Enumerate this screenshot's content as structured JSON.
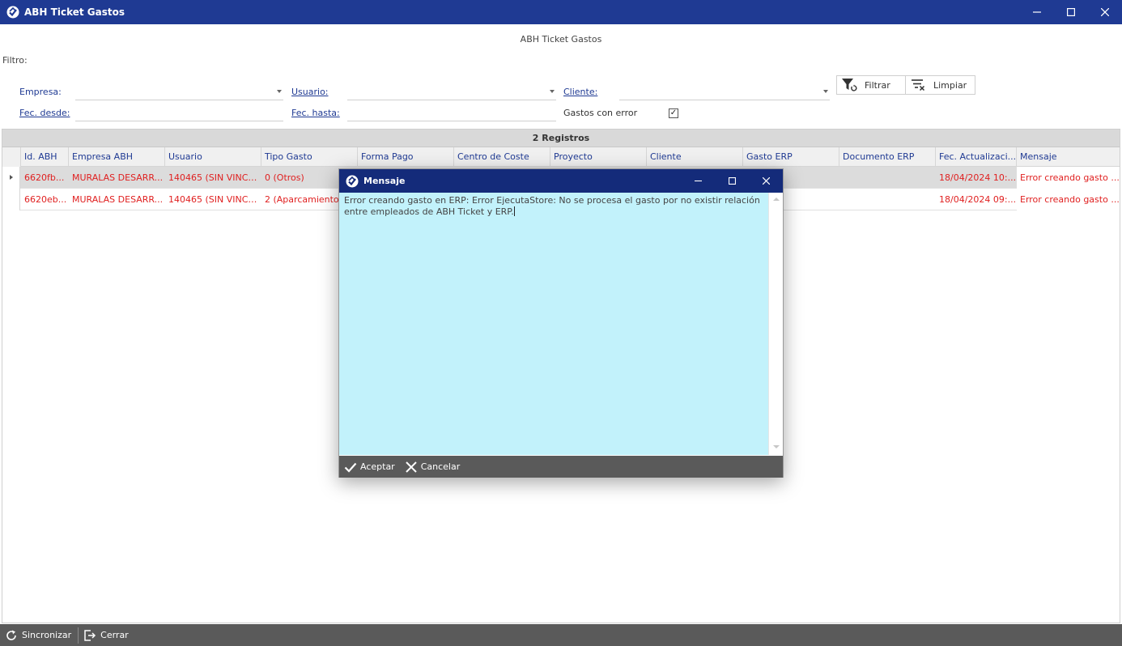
{
  "window": {
    "title": "ABH Ticket Gastos",
    "min": "–",
    "max": "☐",
    "close": "✕"
  },
  "header": {
    "center_title": "ABH Ticket Gastos"
  },
  "filter": {
    "section_label": "Filtro:",
    "empresa_label": "Empresa:",
    "empresa_value": "",
    "usuario_label": "Usuario:",
    "usuario_value": "",
    "cliente_label": "Cliente:",
    "cliente_value": "",
    "fec_desde_label": "Fec. desde:",
    "fec_desde_value": "",
    "fec_hasta_label": "Fec. hasta:",
    "fec_hasta_value": "",
    "gastos_error_label": "Gastos con error",
    "gastos_error_checked": "✓",
    "filtrar_label": "Filtrar",
    "limpiar_label": "Limpiar"
  },
  "grid": {
    "title": "2 Registros",
    "columns": [
      "Id. ABH",
      "Empresa ABH",
      "Usuario",
      "Tipo Gasto",
      "Forma Pago",
      "Centro de Coste",
      "Proyecto",
      "Cliente",
      "Gasto ERP",
      "Documento ERP",
      "Fec. Actualizaci...",
      "Mensaje"
    ],
    "rows": [
      {
        "id": "6620fb...",
        "empresa": "MURALAS DESARR...",
        "usuario": "140465 (SIN VINCU...",
        "tipo": "0 (Otros)",
        "fecha": "18/04/2024 10:...",
        "mensaje": "Error creando gasto ..."
      },
      {
        "id": "6620eb...",
        "empresa": "MURALAS DESARR...",
        "usuario": "140465 (SIN VINCU...",
        "tipo": "2 (Aparcamiento)",
        "fecha": "18/04/2024 09:...",
        "mensaje": "Error creando gasto ..."
      }
    ],
    "text_color": "#e02020"
  },
  "bottombar": {
    "sincronizar_label": "Sincronizar",
    "cerrar_label": "Cerrar"
  },
  "dialog": {
    "title": "Mensaje",
    "message": "Error creando gasto en ERP: Error EjecutaStore: No se procesa el gasto por no existir relación entre empleados de ABH Ticket y ERP.",
    "aceptar_label": "Aceptar",
    "cancelar_label": "Cancelar",
    "min": "–",
    "max": "☐",
    "close": "✕",
    "body_color": "#c2f2fb"
  },
  "colors": {
    "titlebar": "#1f3a93",
    "dialog_titlebar": "#142b7a",
    "footer": "#5a5a5a",
    "link": "#1f3a93"
  }
}
